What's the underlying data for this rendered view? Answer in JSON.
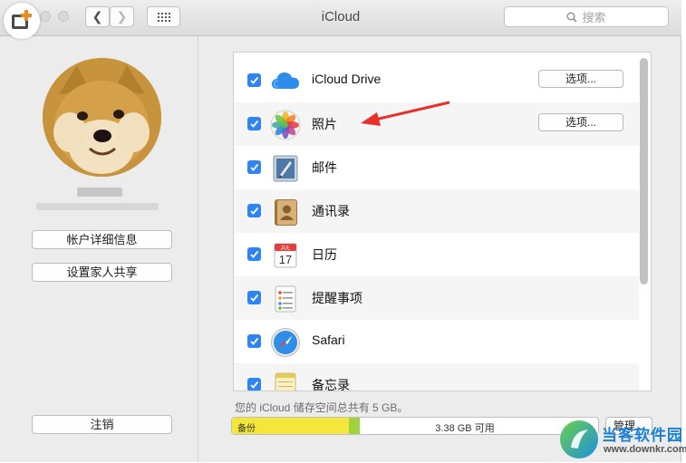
{
  "window": {
    "title": "iCloud"
  },
  "search": {
    "placeholder": "搜索"
  },
  "account": {
    "buttons": {
      "details": "帐户详细信息",
      "family": "设置家人共享",
      "signout": "注销"
    }
  },
  "services": [
    {
      "name": "iCloud Drive",
      "checked": true,
      "options_label": "选项...",
      "icon": "icloud-drive-icon"
    },
    {
      "name": "照片",
      "checked": true,
      "options_label": "选项...",
      "icon": "photos-icon"
    },
    {
      "name": "邮件",
      "checked": true,
      "icon": "mail-icon"
    },
    {
      "name": "通讯录",
      "checked": true,
      "icon": "contacts-icon"
    },
    {
      "name": "日历",
      "checked": true,
      "icon": "calendar-icon",
      "icon_month": "JUL",
      "icon_day": "17"
    },
    {
      "name": "提醒事项",
      "checked": true,
      "icon": "reminders-icon"
    },
    {
      "name": "Safari",
      "checked": true,
      "icon": "safari-icon"
    },
    {
      "name": "备忘录",
      "checked": true,
      "icon": "notes-icon"
    }
  ],
  "storage": {
    "summary": "您的 iCloud 储存空间总共有 5 GB。",
    "backup_label": "备份",
    "free_label": "3.38 GB 可用",
    "backup_fraction": 0.32,
    "other_fraction": 0.03,
    "manage_label": "管理...",
    "colors": {
      "backup": "#f5e63a",
      "other": "#9fd23c"
    }
  },
  "watermark": {
    "title": "当客软件园",
    "url": "www.downkr.com"
  },
  "colors": {
    "checkbox": "#2f84f4",
    "annotation_arrow": "#e8302a"
  }
}
